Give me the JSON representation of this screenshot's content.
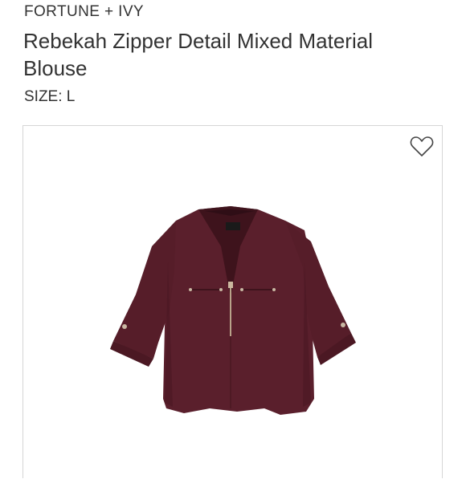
{
  "product": {
    "brand": "FORTUNE + IVY",
    "title": "Rebekah  Zipper Detail Mixed Material Blouse",
    "size_label": "SIZE: L"
  },
  "image_card": {
    "favorite_icon": "heart-outline-icon",
    "garment_color": "#5a1f2c",
    "image_alt": "Burgundy blouse with zipper detail"
  }
}
